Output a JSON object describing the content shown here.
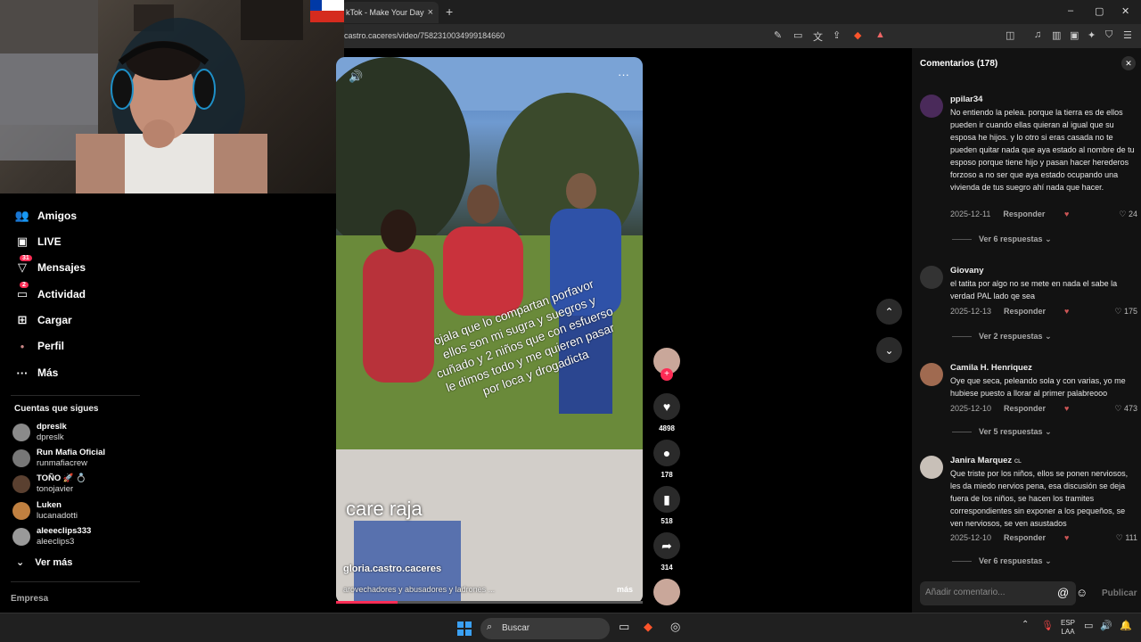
{
  "browser": {
    "tab_title": "kTok - Make Your Day",
    "tab_close": "×",
    "new_tab": "+",
    "url": "castro.caceres/video/7582310034999184660",
    "window_buttons": [
      "–",
      "▢",
      "✕"
    ]
  },
  "sidebar": {
    "items": [
      {
        "label": "Amigos",
        "icon": "friends-icon",
        "glyph": "👥"
      },
      {
        "label": "LIVE",
        "icon": "live-icon",
        "glyph": "▣"
      },
      {
        "label": "Mensajes",
        "icon": "messages-icon",
        "glyph": "▽",
        "badge": "31"
      },
      {
        "label": "Actividad",
        "icon": "activity-icon",
        "glyph": "▭",
        "badge": "2"
      },
      {
        "label": "Cargar",
        "icon": "upload-icon",
        "glyph": "⊞"
      },
      {
        "label": "Perfil",
        "icon": "profile-icon",
        "glyph": "●"
      },
      {
        "label": "Más",
        "icon": "more-icon",
        "glyph": "···"
      }
    ],
    "following_title": "Cuentas que sigues",
    "accounts": [
      {
        "name": "dpreslk",
        "handle": "dpreslk",
        "color": "#8a8a8a"
      },
      {
        "name": "Run Mafia Oficial",
        "handle": "runmafiacrew",
        "color": "#777"
      },
      {
        "name": "TOÑO 🚀 💍",
        "handle": "tonojavier",
        "color": "#5a4030"
      },
      {
        "name": "Luken",
        "handle": "lucanadotti",
        "color": "#c08040"
      },
      {
        "name": "aleeeclips333",
        "handle": "aleeclips3",
        "color": "#999"
      }
    ],
    "see_more": "Ver más",
    "company": "Empresa"
  },
  "video": {
    "caption_overlay": "ojala que lo compartan porfavor ellos son mi sugra y suegros y cuñado y 2 niños que con esfuerso le dimos todo y me quieren pasar por loca y drogadicta",
    "big_text": "care raja",
    "author": "gloria.castro.caceres",
    "description": "arovechadores y abusadores y ladrones ...",
    "more": "más",
    "progress": 0.2
  },
  "actions": {
    "likes": "4898",
    "comments": "178",
    "saves": "518",
    "shares": "314"
  },
  "comments_panel": {
    "title": "Comentarios",
    "count": "(178)",
    "reply_label": "Responder",
    "input_placeholder": "Añadir comentario...",
    "post_label": "Publicar",
    "comments": [
      {
        "user": "ppilar34",
        "avatar_color": "#4a2a5a",
        "text": "No entiendo la pelea. porque la tierra es de ellos pueden ir cuando ellas quieran al igual que su esposa he hijos. y lo otro si eras casada no te pueden quitar nada que aya estado al nombre de tu esposo porque tiene hijo y pasan hacer herederos forzoso a no ser que aya estado ocupando una vivienda de tus suegro ahí nada que hacer.",
        "date": "2025-12-11",
        "likes": "24",
        "replies": "Ver 6 respuestas"
      },
      {
        "user": "Giovany",
        "avatar_color": "#333",
        "text": "el tatita por algo no se mete en nada el sabe la verdad PAL lado qe sea",
        "date": "2025-12-13",
        "likes": "175",
        "replies": "Ver 2 respuestas"
      },
      {
        "user": "Camila H. Henriquez",
        "avatar_color": "#a06a50",
        "text": "Oye que seca, peleando sola y con varias, yo me hubiese puesto a llorar al primer palabreooo",
        "date": "2025-12-10",
        "likes": "473",
        "replies": "Ver 5 respuestas"
      },
      {
        "user": "Janira Marquez",
        "user_flag": "CL",
        "avatar_color": "#c8c0b8",
        "text": "Que triste por los niños, ellos se ponen nerviosos, les da miedo nervios pena, esa discusión se deja fuera de los niños, se hacen los tramites correspondientes sin exponer a los pequeños, se ven nerviosos, se ven asustados",
        "date": "2025-12-10",
        "likes": "111",
        "replies": "Ver 6 respuestas"
      }
    ]
  },
  "taskbar": {
    "search_label": "Buscar",
    "lang_line1": "ESP",
    "lang_line2": "LAA"
  }
}
